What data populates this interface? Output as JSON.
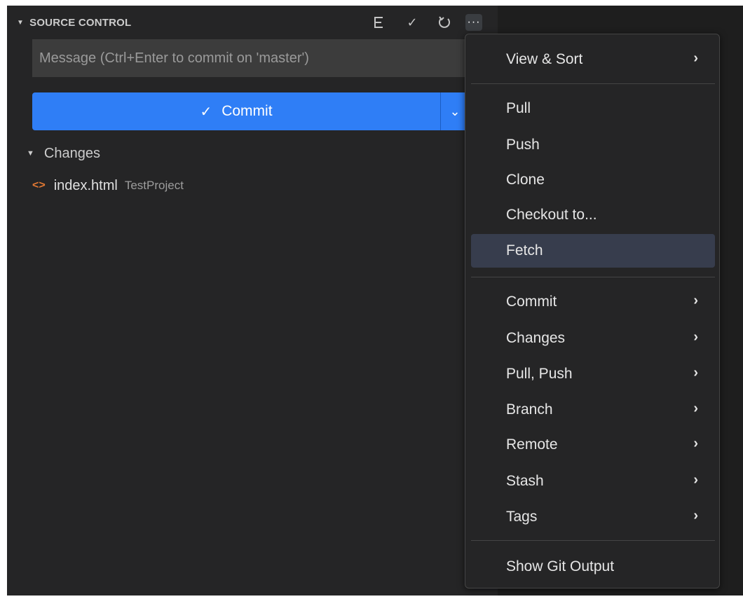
{
  "header": {
    "title": "SOURCE CONTROL",
    "icons": [
      "view-as-tree-icon",
      "commit-check-icon",
      "refresh-icon",
      "more-actions-icon"
    ]
  },
  "commit_input": {
    "placeholder": "Message (Ctrl+Enter to commit on 'master')"
  },
  "commit_button": {
    "label": "Commit"
  },
  "changes": {
    "label": "Changes",
    "files": [
      {
        "name": "index.html",
        "folder": "TestProject"
      }
    ]
  },
  "menu": {
    "items": [
      {
        "label": "View & Sort",
        "submenu": true
      },
      {
        "label": "Pull"
      },
      {
        "label": "Push"
      },
      {
        "label": "Clone"
      },
      {
        "label": "Checkout to..."
      },
      {
        "label": "Fetch",
        "highlighted": true
      },
      {
        "label": "Commit",
        "submenu": true
      },
      {
        "label": "Changes",
        "submenu": true
      },
      {
        "label": "Pull, Push",
        "submenu": true
      },
      {
        "label": "Branch",
        "submenu": true
      },
      {
        "label": "Remote",
        "submenu": true
      },
      {
        "label": "Stash",
        "submenu": true
      },
      {
        "label": "Tags",
        "submenu": true
      },
      {
        "label": "Show Git Output"
      }
    ]
  },
  "colors": {
    "accent": "#2f7ef6",
    "panel_bg": "#252526",
    "highlight": "#373d4d"
  }
}
